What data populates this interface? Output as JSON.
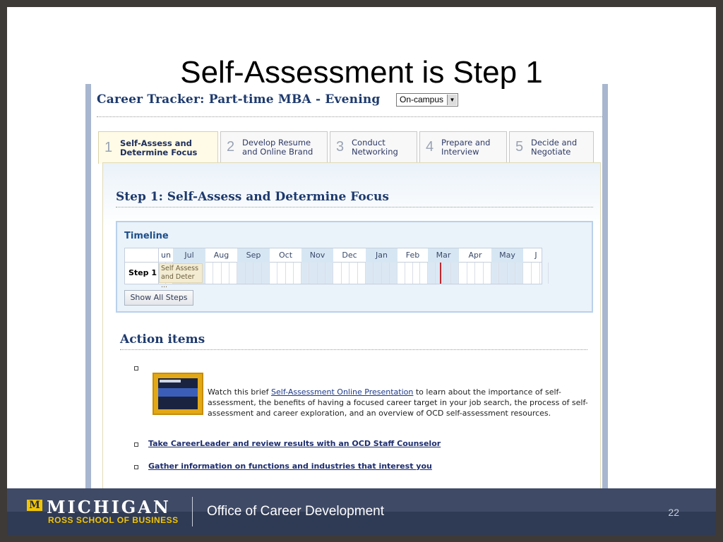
{
  "slide": {
    "title": "Self-Assessment is Step 1",
    "page_number": "22"
  },
  "app": {
    "tracker_title": "Career Tracker: Part-time MBA - Evening",
    "campus_select": {
      "value": "On-campus"
    },
    "tabs": [
      {
        "num": "1",
        "line1": "Self-Assess and",
        "line2": "Determine Focus",
        "active": true
      },
      {
        "num": "2",
        "line1": "Develop Resume",
        "line2": "and Online Brand",
        "active": false
      },
      {
        "num": "3",
        "line1": "Conduct",
        "line2": "Networking",
        "active": false
      },
      {
        "num": "4",
        "line1": "Prepare and",
        "line2": "Interview",
        "active": false
      },
      {
        "num": "5",
        "line1": "Decide and",
        "line2": "Negotiate",
        "active": false
      }
    ],
    "step_heading": "Step 1: Self-Assess and Determine Focus",
    "timeline": {
      "title": "Timeline",
      "months": [
        "un",
        "Jul",
        "Aug",
        "Sep",
        "Oct",
        "Nov",
        "Dec",
        "Jan",
        "Feb",
        "Mar",
        "Apr",
        "May",
        "J"
      ],
      "row_label": "Step 1",
      "bar_text_line1": "Self Assess",
      "bar_text_line2": "and Deter ...",
      "show_all_label": "Show All Steps"
    },
    "action_items": {
      "heading": "Action items",
      "video_text_before": "Watch this brief ",
      "video_link": "Self-Assessment Online Presentation",
      "video_text_after": " to learn about the importance of self-assessment, the benefits of having a focused career target in your job search, the process of self-assessment and career exploration, and an overview of OCD self-assessment resources.",
      "links": [
        "Take CareerLeader and review results with an OCD Staff Counselor",
        "Gather information on functions and industries that interest you"
      ]
    }
  },
  "footer": {
    "logo_m": "M",
    "logo_name": "MICHIGAN",
    "logo_school": "ROSS SCHOOL OF BUSINESS",
    "office": "Office of Career Development"
  }
}
